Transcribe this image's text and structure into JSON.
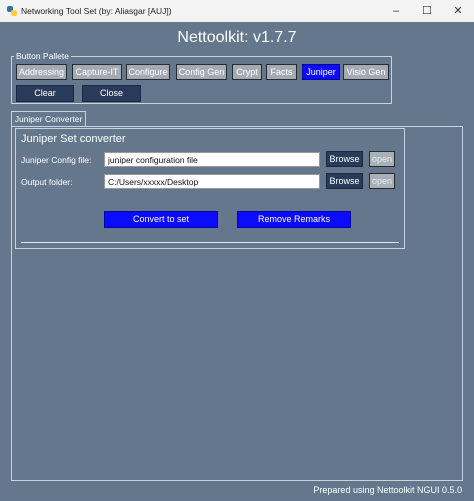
{
  "window": {
    "title": "Networking Tool Set  (by: Aliasgar [AUJ])",
    "controls": [
      "–",
      "☐",
      "✕"
    ]
  },
  "header": {
    "title": "Nettoolkit: v1.7.7"
  },
  "button_pallete": {
    "label": "Button Pallete",
    "tools": [
      "Addressing",
      "Capture-IT",
      "Configure",
      "Config Gen",
      "Crypt",
      "Facts",
      "Juniper",
      "Visio Gen"
    ],
    "active_tool": "Juniper",
    "clear_label": "Clear",
    "close_label": "Close"
  },
  "tab": {
    "label": "Juniper Converter"
  },
  "converter": {
    "title": "Juniper Set converter",
    "config_label": "Juniper Config file:",
    "config_value": "juniper configuration file",
    "output_label": "Output folder:",
    "output_value": "C:/Users/xxxxx/Desktop",
    "browse_label": "Browse",
    "open_label": "open",
    "convert_label": "Convert to set",
    "remove_label": "Remove Remarks"
  },
  "footer": {
    "text": "Prepared using Nettoolkit NGUI 0.5.0"
  },
  "colors": {
    "background": "#64778d",
    "navy_button": "#283b5b",
    "accent_blue": "#0a0bff",
    "gray_button": "#a2abb4"
  }
}
